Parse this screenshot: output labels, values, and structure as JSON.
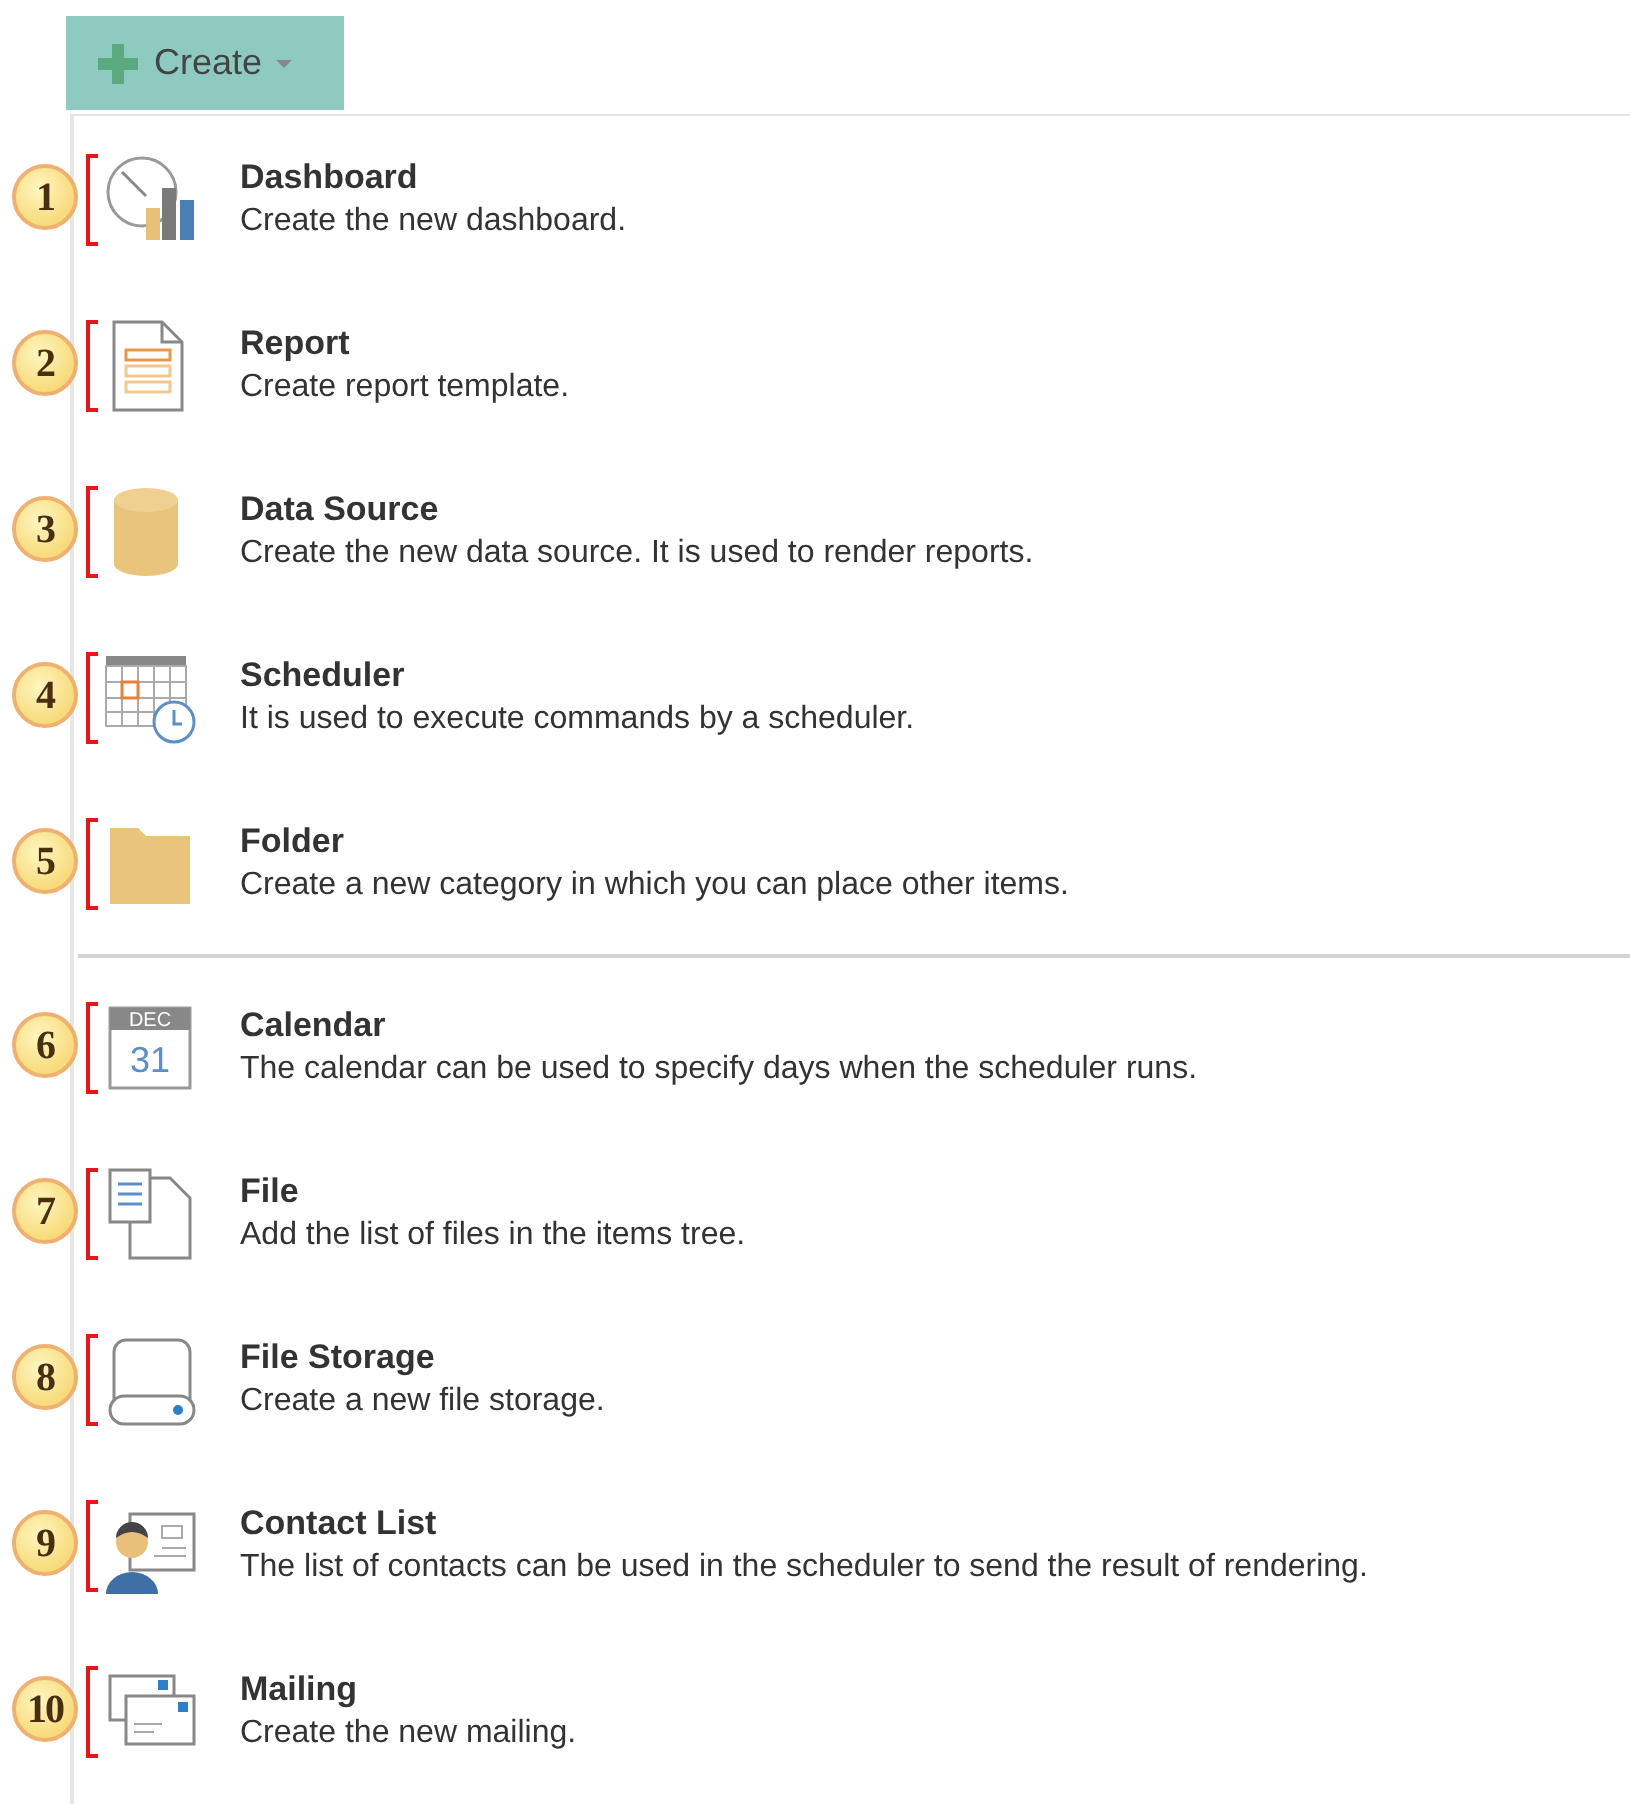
{
  "create_button": {
    "label": "Create"
  },
  "groups": [
    {
      "items": [
        {
          "badge": "1",
          "kind": "dashboard",
          "title": "Dashboard",
          "description": "Create the new dashboard."
        },
        {
          "badge": "2",
          "kind": "report",
          "title": "Report",
          "description": "Create report template."
        },
        {
          "badge": "3",
          "kind": "datasource",
          "title": "Data Source",
          "description": "Create the new data source. It is used to render reports."
        },
        {
          "badge": "4",
          "kind": "scheduler",
          "title": "Scheduler",
          "description": "It is used to execute commands by a scheduler."
        },
        {
          "badge": "5",
          "kind": "folder",
          "title": "Folder",
          "description": "Create a new category in which you can place other items."
        }
      ]
    },
    {
      "items": [
        {
          "badge": "6",
          "kind": "calendar",
          "title": "Calendar",
          "description": "The calendar can be used to specify days when the scheduler runs.",
          "icon_month": "DEC",
          "icon_day": "31"
        },
        {
          "badge": "7",
          "kind": "file",
          "title": "File",
          "description": "Add the list of files in the items tree."
        },
        {
          "badge": "8",
          "kind": "storage",
          "title": "File Storage",
          "description": "Create a new file storage."
        },
        {
          "badge": "9",
          "kind": "contacts",
          "title": "Contact List",
          "description": "The list of contacts can be used in the scheduler to send the result of rendering."
        },
        {
          "badge": "10",
          "kind": "mailing",
          "title": "Mailing",
          "description": "Create the new mailing."
        }
      ]
    }
  ]
}
